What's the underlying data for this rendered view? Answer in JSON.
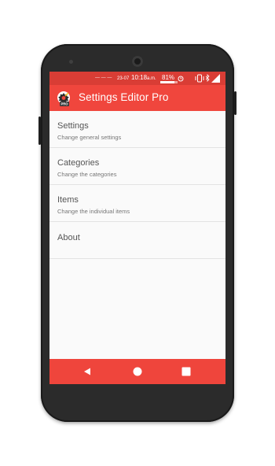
{
  "status_bar": {
    "date": "23-07",
    "time": "10:18",
    "ampm": "a.m.",
    "battery": "81%"
  },
  "app_bar": {
    "title": "Settings Editor Pro",
    "icon_badge": "PRO"
  },
  "menu": [
    {
      "title": "Settings",
      "subtitle": "Change general settings"
    },
    {
      "title": "Categories",
      "subtitle": "Change the categories"
    },
    {
      "title": "Items",
      "subtitle": "Change the individual items"
    },
    {
      "title": "About",
      "subtitle": ""
    }
  ],
  "colors": {
    "status_bar": "#d93d35",
    "app_bar": "#f0463d",
    "nav_bar": "#ef453c",
    "background": "#fafafa"
  },
  "icons": {
    "back": "back-triangle-icon",
    "home": "home-circle-icon",
    "recents": "recents-square-icon"
  }
}
